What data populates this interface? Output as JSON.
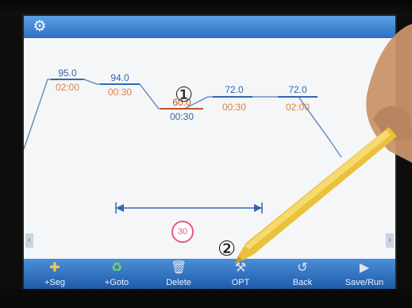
{
  "markers": {
    "one": "①",
    "two": "②"
  },
  "segments": [
    {
      "temp": "95.0",
      "time": "02:00"
    },
    {
      "temp": "94.0",
      "time": "00:30"
    },
    {
      "temp": "60.0",
      "time": "00:30"
    },
    {
      "temp": "72.0",
      "time": "00:30"
    },
    {
      "temp": "72.0",
      "time": "02:00"
    }
  ],
  "cycles": "30",
  "nav": {
    "left": "‹",
    "right": "›"
  },
  "toolbar": {
    "seg_label": "+Seg",
    "goto_label": "+Goto",
    "delete_label": "Delete",
    "opt_label": "OPT",
    "back_label": "Back",
    "saverun_label": "Save/Run"
  },
  "icons": {
    "settings": "gear-icon",
    "seg": "add-segment-icon",
    "goto": "recycle-icon",
    "delete": "trash-icon",
    "opt": "wrench-icon",
    "back": "back-arrow-icon",
    "saverun": "run-icon"
  },
  "colors": {
    "titlebar": "#2f6fc2",
    "temp_text": "#3467b0",
    "time_text": "#e0823c",
    "low_step_line": "#c45124",
    "cycle_badge": "#e55a7a",
    "pen": "#e9c23a"
  }
}
